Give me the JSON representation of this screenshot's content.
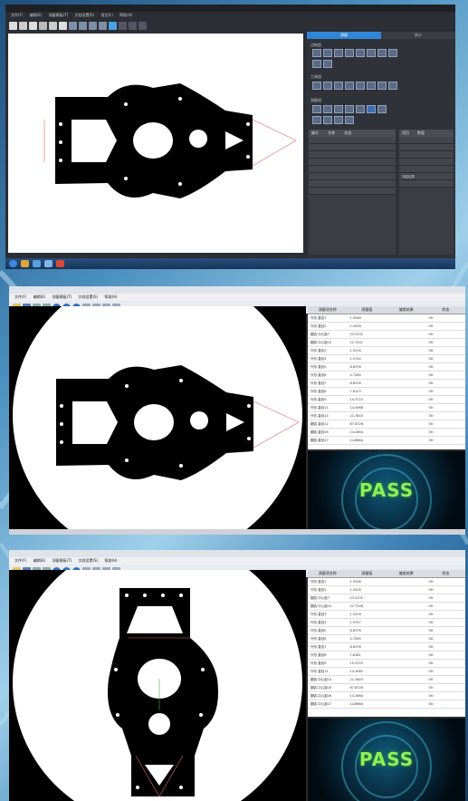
{
  "colors": {
    "accent_tab": "#2f86d6",
    "pass_text": "#8df05a",
    "dark_panel": "#2f3238",
    "part": "#000000",
    "contour_line": "#e06666"
  },
  "window1": {
    "tabs": [
      "测量",
      "统计"
    ],
    "sections": [
      "点构造",
      "工具组",
      "测量组"
    ],
    "grid_left_headers": [
      "编号",
      "名称",
      "状态"
    ],
    "grid_right_headers": [
      "项目",
      "数值"
    ],
    "grid_right_note": "测量结果"
  },
  "window2": {
    "table": {
      "headers": [
        "测量项名称",
        "测量值",
        "偏差结果",
        "状态"
      ],
      "rows": [
        {
          "name": "外形-直径1",
          "value": "1.9446",
          "dev": "",
          "status": "OK"
        },
        {
          "name": "外形-直径2",
          "value": "1.2026",
          "dev": "",
          "status": "OK"
        },
        {
          "name": "圆弧-中心距7",
          "value": "23.2232",
          "dev": "",
          "status": "OK"
        },
        {
          "name": "圆弧-中心距10",
          "value": "22.7241",
          "dev": "",
          "status": "OK"
        },
        {
          "name": "外形-直径3",
          "value": "1.5218",
          "dev": "",
          "status": "OK"
        },
        {
          "name": "外形-直径4",
          "value": "1.5744",
          "dev": "",
          "status": "OK"
        },
        {
          "name": "外形-直径5",
          "value": "8.8376",
          "dev": "",
          "status": "OK"
        },
        {
          "name": "外形-直径6",
          "value": "4.7265",
          "dev": "",
          "status": "OK"
        },
        {
          "name": "外形-直径7",
          "value": "8.8376",
          "dev": "",
          "status": "OK"
        },
        {
          "name": "外形-直径8",
          "value": "7.8123",
          "dev": "",
          "status": "OK"
        },
        {
          "name": "外形-直径9",
          "value": "10.3724",
          "dev": "",
          "status": "OK"
        },
        {
          "name": "外形-直径11",
          "value": "14.4968",
          "dev": "",
          "status": "OK"
        },
        {
          "name": "外形-直径14",
          "value": "21.1643",
          "dev": "",
          "status": "OK"
        },
        {
          "name": "圆弧-直径22",
          "value": "67.8726",
          "dev": "",
          "status": "OK"
        },
        {
          "name": "圆弧-直径26",
          "value": "14.2664",
          "dev": "",
          "status": "OK"
        },
        {
          "name": "圆弧-直径27",
          "value": "14.8664",
          "dev": "",
          "status": "OK"
        }
      ]
    },
    "pass_label": "PASS"
  },
  "window3": {
    "table": {
      "headers": [
        "测量项名称",
        "测量值",
        "偏差结果",
        "状态"
      ],
      "rows": [
        {
          "name": "外形-直径1",
          "value": "1.9436",
          "dev": "",
          "status": "OK"
        },
        {
          "name": "外形-直径2",
          "value": "1.2028",
          "dev": "",
          "status": "OK"
        },
        {
          "name": "圆弧-中心距7",
          "value": "23.2232",
          "dev": "",
          "status": "OK"
        },
        {
          "name": "圆弧-中心距10",
          "value": "22.7248",
          "dev": "",
          "status": "OK"
        },
        {
          "name": "外形-直径3",
          "value": "1.5418",
          "dev": "",
          "status": "OK"
        },
        {
          "name": "外形-直径4",
          "value": "1.5707",
          "dev": "",
          "status": "OK"
        },
        {
          "name": "外形-直径5",
          "value": "8.8376",
          "dev": "",
          "status": "OK"
        },
        {
          "name": "外形-直径6",
          "value": "4.7265",
          "dev": "",
          "status": "OK"
        },
        {
          "name": "外形-直径7",
          "value": "8.8376",
          "dev": "",
          "status": "OK"
        },
        {
          "name": "外形-直径8",
          "value": "7.8161",
          "dev": "",
          "status": "OK"
        },
        {
          "name": "外形-直径9",
          "value": "10.3725",
          "dev": "",
          "status": "OK"
        },
        {
          "name": "外形-直径11",
          "value": "14.4982",
          "dev": "",
          "status": "OK"
        },
        {
          "name": "圆弧-中心距14",
          "value": "21.1643",
          "dev": "",
          "status": "OK"
        },
        {
          "name": "圆弧-中心距18",
          "value": "67.8726",
          "dev": "",
          "status": "OK"
        },
        {
          "name": "圆弧-中心距26",
          "value": "14.2664",
          "dev": "",
          "status": "OK"
        },
        {
          "name": "圆弧-中心距27",
          "value": "14.8664",
          "dev": "",
          "status": "OK"
        }
      ]
    },
    "pass_label": "PASS"
  },
  "menus": [
    "文件(F)",
    "编辑(E)",
    "测量模板(T)",
    "文档设置(S)",
    "语言(L)",
    "帮助(H)"
  ]
}
